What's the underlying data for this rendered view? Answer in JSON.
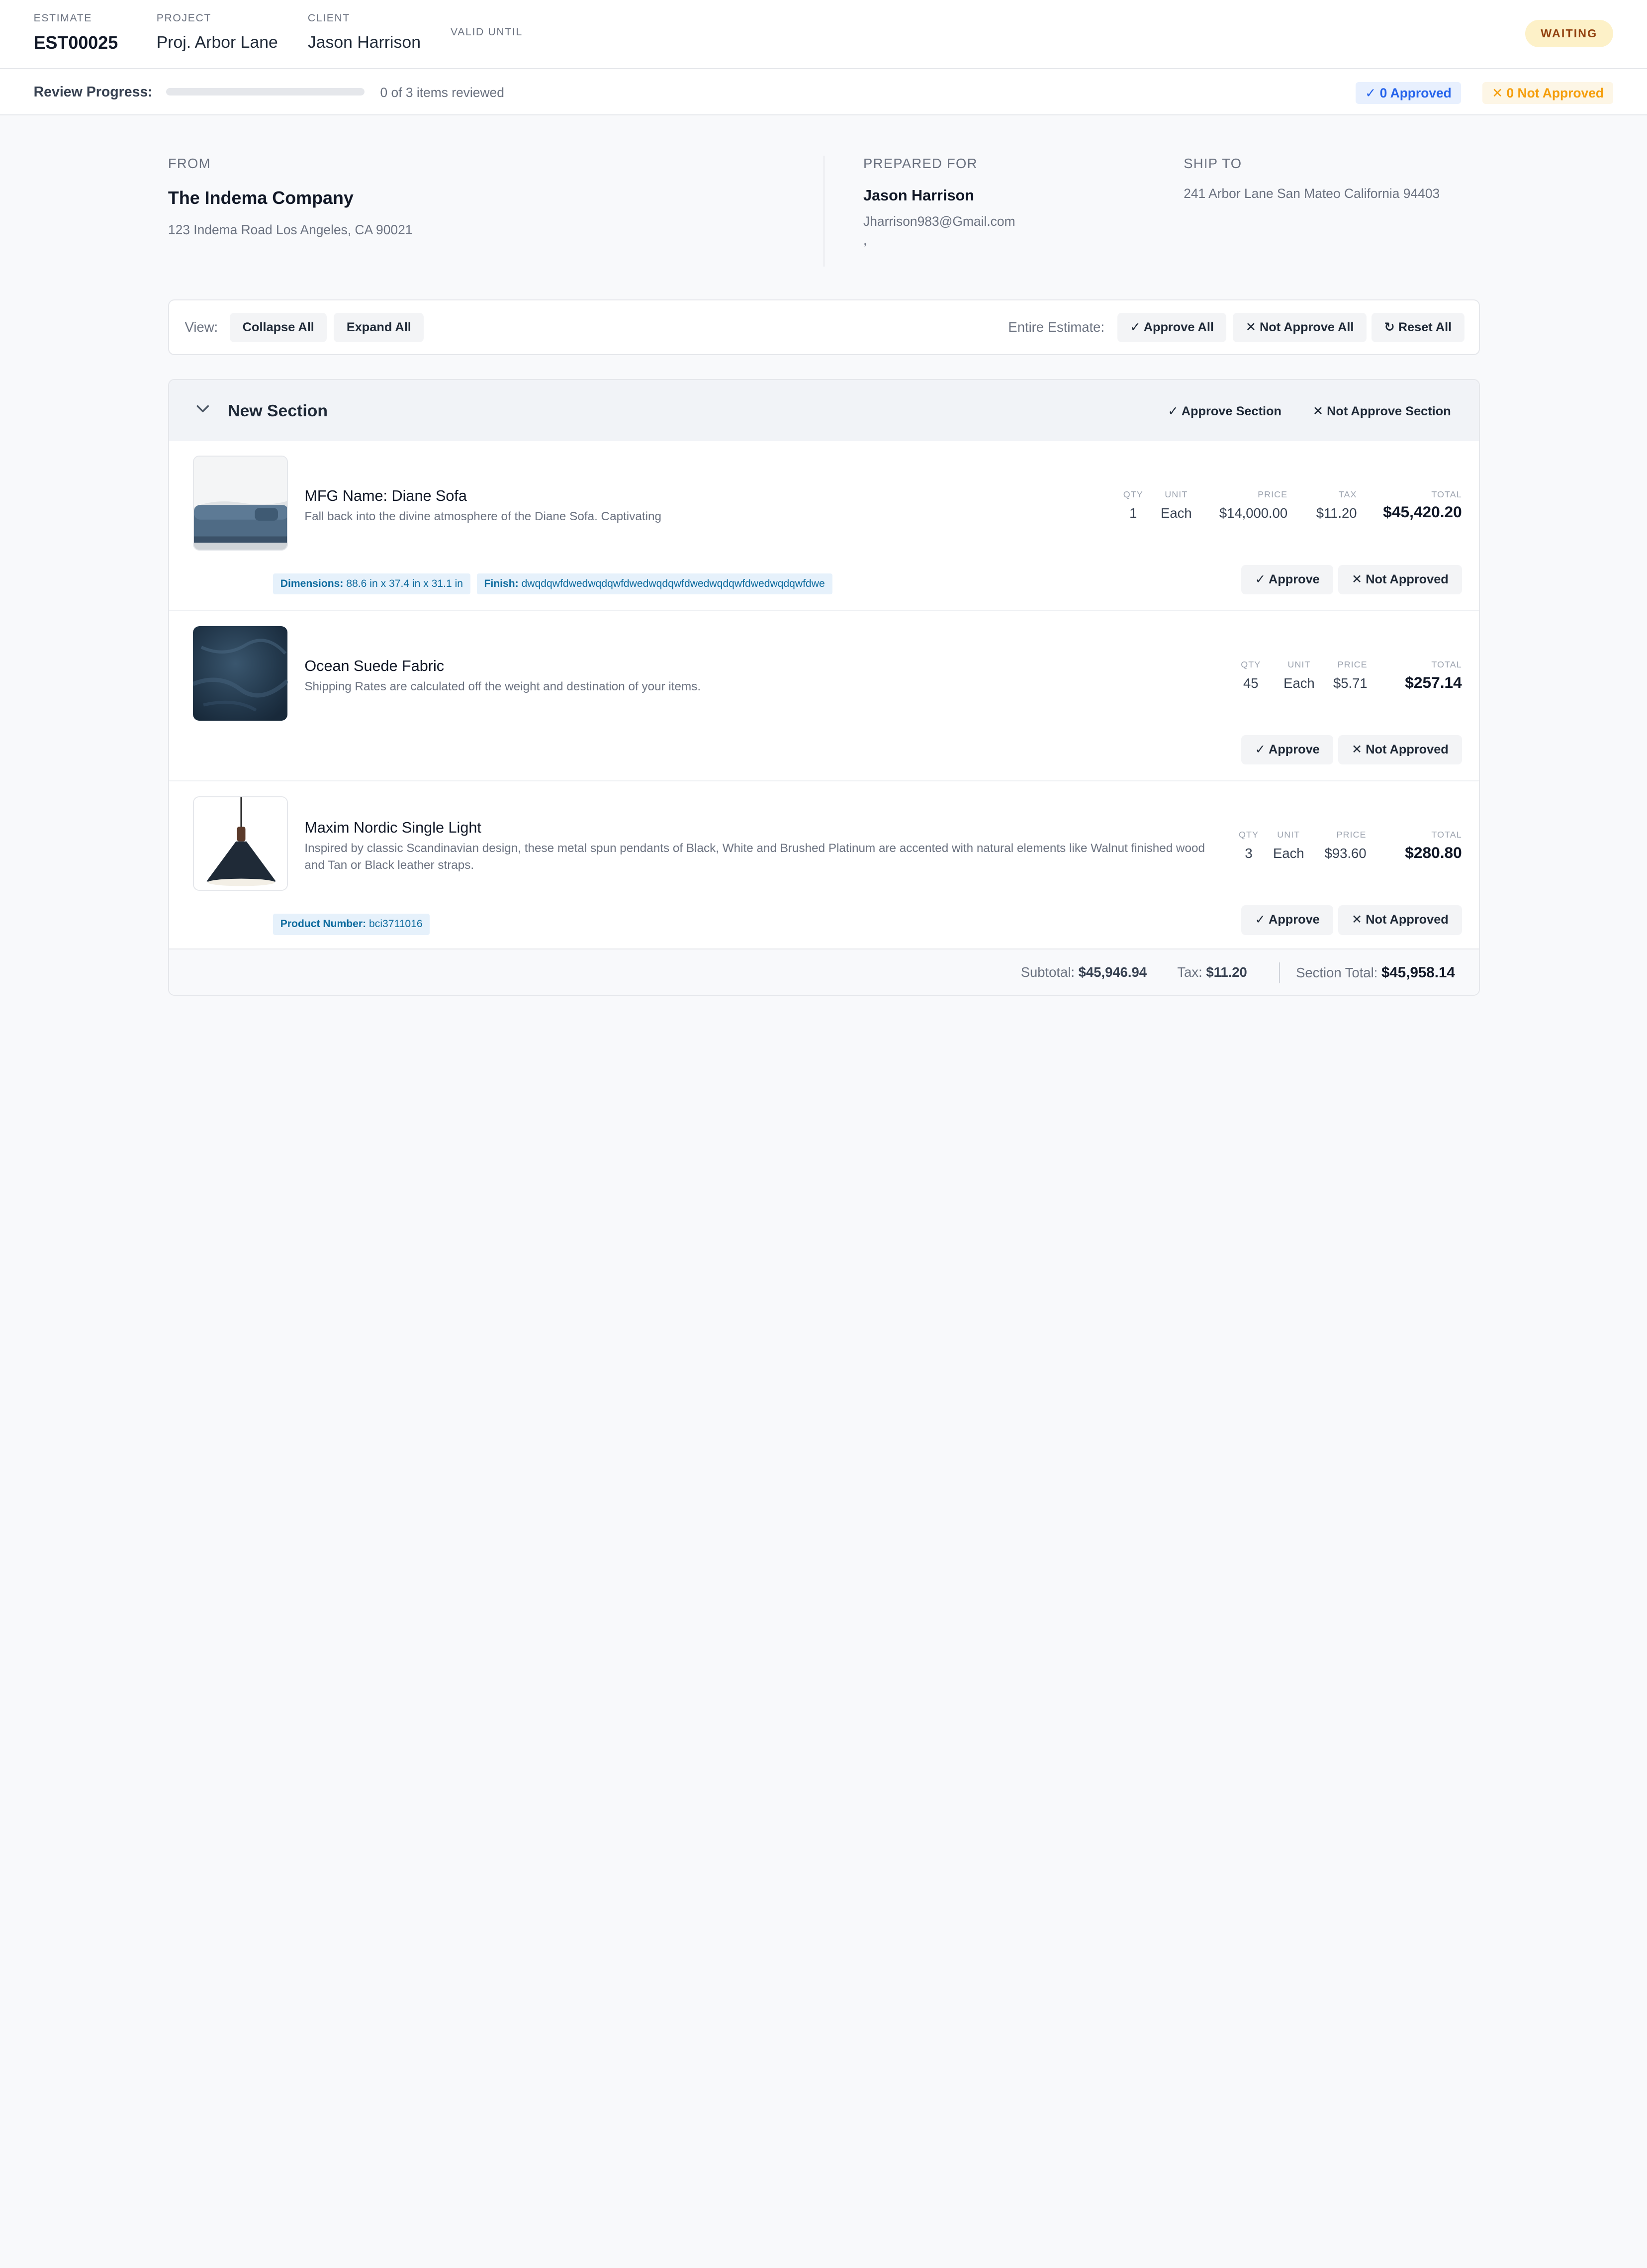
{
  "header": {
    "estimate_label": "ESTIMATE",
    "estimate_value": "EST00025",
    "project_label": "PROJECT",
    "project_value": "Proj. Arbor Lane",
    "client_label": "CLIENT",
    "client_value": "Jason Harrison",
    "valid_label": "VALID UNTIL",
    "status": "WAITING"
  },
  "progress": {
    "label": "Review Progress:",
    "reviewed_fraction": 0,
    "text": "0 of 3 items reviewed",
    "approved": "✓ 0 Approved",
    "not_approved": "✕ 0 Not Approved"
  },
  "from": {
    "label": "FROM",
    "name": "The Indema Company",
    "address": "123 Indema Road Los Angeles, CA 90021"
  },
  "prepared_for": {
    "label": "PREPARED FOR",
    "name": "Jason Harrison",
    "email": "Jharrison983@Gmail.com",
    "extra": ","
  },
  "ship_to": {
    "label": "SHIP TO",
    "address": "241 Arbor Lane San Mateo California 94403"
  },
  "toolbar": {
    "view_label": "View:",
    "collapse_all": "Collapse All",
    "expand_all": "Expand All",
    "entire_label": "Entire Estimate:",
    "approve_all": "✓ Approve All",
    "not_approve_all": "✕ Not Approve All",
    "reset_all": "↻ Reset All"
  },
  "section": {
    "title": "New Section",
    "approve_section": "✓ Approve Section",
    "not_approve_section": "✕ Not Approve Section",
    "items": [
      {
        "name": "MFG Name: Diane Sofa",
        "description": "Fall back into the divine atmosphere of the Diane Sofa. Captivating",
        "qty_label": "QTY",
        "qty": "1",
        "unit_label": "UNIT",
        "unit": "Each",
        "price_label": "PRICE",
        "price": "$14,000.00",
        "tax_label": "TAX",
        "tax": "$11.20",
        "total_label": "TOTAL",
        "total": "$45,420.20",
        "tags": [
          {
            "key": "Dimensions:",
            "value": "88.6 in x 37.4 in x 31.1 in"
          },
          {
            "key": "Finish:",
            "value": "dwqdqwfdwedwqdqwfdwedwqdqwfdwedwqdqwfdwedwqdqwfdwe"
          }
        ],
        "approve": "✓ Approve",
        "not_approve": "✕ Not Approved"
      },
      {
        "name": "Ocean Suede Fabric",
        "description": "Shipping Rates are calculated off the weight and destination of your items.",
        "qty_label": "QTY",
        "qty": "45",
        "unit_label": "UNIT",
        "unit": "Each",
        "price_label": "PRICE",
        "price": "$5.71",
        "total_label": "TOTAL",
        "total": "$257.14",
        "approve": "✓ Approve",
        "not_approve": "✕ Not Approved"
      },
      {
        "name": "Maxim Nordic Single Light",
        "description": "Inspired by classic Scandinavian design, these metal spun pendants of Black, White and Brushed Platinum are accented with natural elements like Walnut finished wood and Tan or Black leather straps.",
        "qty_label": "QTY",
        "qty": "3",
        "unit_label": "UNIT",
        "unit": "Each",
        "price_label": "PRICE",
        "price": "$93.60",
        "total_label": "TOTAL",
        "total": "$280.80",
        "tags": [
          {
            "key": "Product Number:",
            "value": "bci3711016"
          }
        ],
        "approve": "✓ Approve",
        "not_approve": "✕ Not Approved"
      }
    ],
    "footer": {
      "subtotal_label": "Subtotal:",
      "subtotal": "$45,946.94",
      "tax_label": "Tax:",
      "tax": "$11.20",
      "section_total_label": "Section Total:",
      "section_total": "$45,958.14"
    }
  },
  "colors": {
    "accent": "#2563eb",
    "status_waiting_bg": "#fdf1c8",
    "status_waiting_text": "#92400e",
    "not_approved": "#f59e0b",
    "tag_bg": "#e6f1fb",
    "tag_text": "#0e6b9e"
  }
}
